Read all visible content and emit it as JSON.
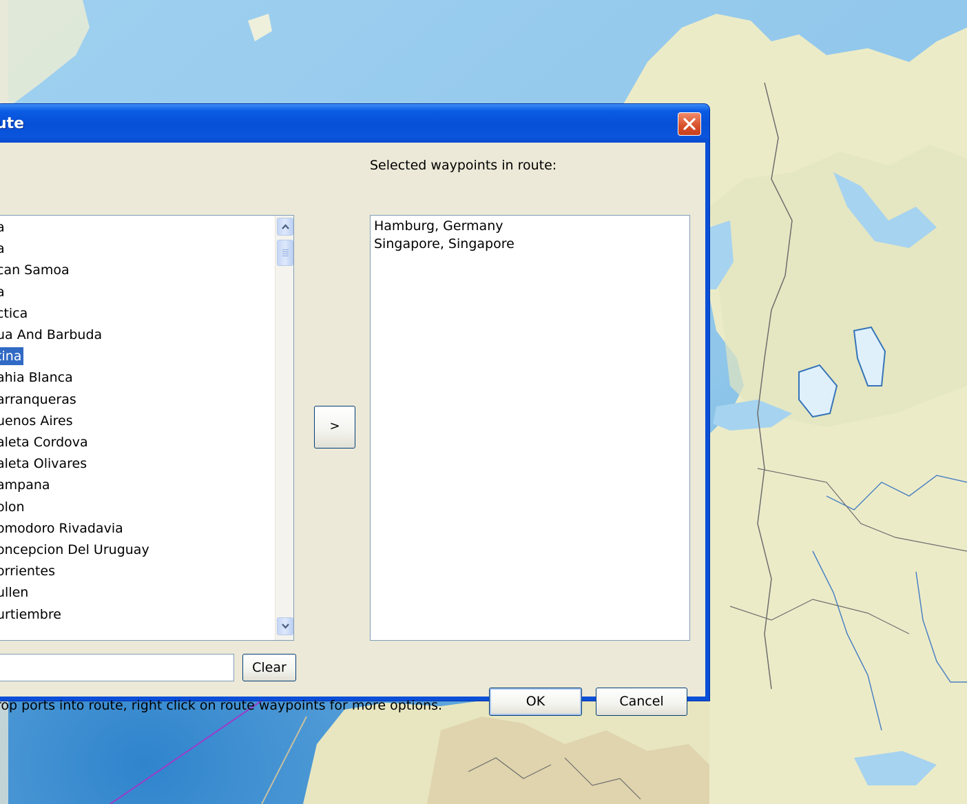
{
  "dialog": {
    "title": "ute",
    "close_icon": "close-x-icon",
    "route_label": "Selected waypoints in route:",
    "add_button": ">",
    "clear_button": "Clear",
    "ok_button": "OK",
    "cancel_button": "Cancel",
    "hint": "rop ports into route, right click on route waypoints for more options."
  },
  "ports": {
    "items": [
      "a",
      "a",
      "can Samoa",
      "a",
      "ctica",
      "ua And Barbuda",
      "tina",
      "ahia Blanca",
      "arranqueras",
      "uenos Aires",
      "aleta Cordova",
      "aleta Olivares",
      "ampana",
      "olon",
      "omodoro Rivadavia",
      "oncepcion Del Uruguay",
      "orrientes",
      "ullen",
      "urtiembre"
    ],
    "selected_index": 6
  },
  "route": {
    "waypoints": [
      "Hamburg, Germany",
      "Singapore, Singapore"
    ]
  },
  "colors": {
    "title_bar": "#0a55dc",
    "selection": "#316ac5",
    "dialog_face": "#ece9d8",
    "ocean": "#a8d2ee",
    "land": "#ecebc8"
  }
}
